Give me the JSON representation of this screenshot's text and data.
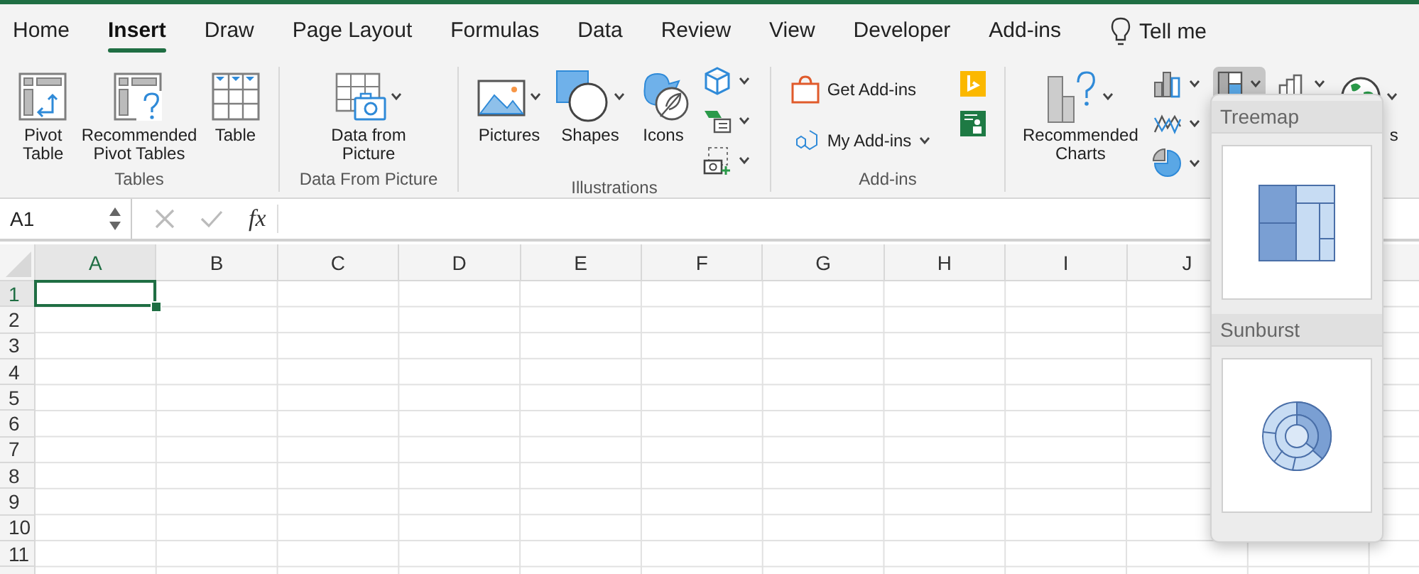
{
  "tabs": [
    {
      "label": "Home",
      "selected": false
    },
    {
      "label": "Insert",
      "selected": true
    },
    {
      "label": "Draw",
      "selected": false
    },
    {
      "label": "Page Layout",
      "selected": false
    },
    {
      "label": "Formulas",
      "selected": false
    },
    {
      "label": "Data",
      "selected": false
    },
    {
      "label": "Review",
      "selected": false
    },
    {
      "label": "View",
      "selected": false
    },
    {
      "label": "Developer",
      "selected": false
    },
    {
      "label": "Add-ins",
      "selected": false
    }
  ],
  "tell_me": "Tell me",
  "ribbon": {
    "groups": [
      {
        "label": "Tables",
        "items": [
          {
            "kind": "large",
            "label": "Pivot\nTable",
            "dropdown": false
          },
          {
            "kind": "large",
            "label": "Recommended\nPivot Tables",
            "dropdown": false
          },
          {
            "kind": "large",
            "label": "Table",
            "dropdown": false
          }
        ]
      },
      {
        "label": "Data From Picture",
        "items": [
          {
            "kind": "large",
            "label": "Data from\nPicture",
            "dropdown": true
          }
        ]
      },
      {
        "label": "Illustrations",
        "items": [
          {
            "kind": "large",
            "label": "Pictures",
            "dropdown": true
          },
          {
            "kind": "large",
            "label": "Shapes",
            "dropdown": true
          },
          {
            "kind": "large",
            "label": "Icons",
            "dropdown": false
          },
          {
            "kind": "stack",
            "items": [
              {
                "dropdown": true
              },
              {
                "dropdown": true
              },
              {
                "dropdown": true
              }
            ]
          }
        ]
      },
      {
        "label": "Add-ins",
        "items": [
          {
            "kind": "stack",
            "items": [
              {
                "label": "Get Add-ins",
                "dropdown": false
              },
              {
                "label": "My Add-ins",
                "dropdown": true
              }
            ]
          },
          {
            "kind": "stack",
            "items": [
              {
                "dropdown": false
              },
              {
                "dropdown": false
              }
            ]
          }
        ]
      },
      {
        "items": [
          {
            "kind": "large",
            "label": "Recommended\nCharts",
            "dropdown": true
          },
          {
            "kind": "stack",
            "items": [
              {
                "dropdown": true
              },
              {
                "dropdown": true
              },
              {
                "dropdown": true
              }
            ]
          },
          {
            "kind": "stack",
            "items": [
              {
                "dropdown": true,
                "pressed": true
              }
            ]
          },
          {
            "kind": "stack",
            "items": [
              {
                "dropdown": true,
                "pressed": false
              }
            ]
          },
          {
            "kind": "large",
            "label": "s",
            "dropdown": true
          }
        ]
      }
    ]
  },
  "formula_bar": {
    "name_box": "A1",
    "function_label": "fx"
  },
  "grid": {
    "columns": [
      {
        "label": "A",
        "selected": true
      },
      {
        "label": "B",
        "selected": false
      },
      {
        "label": "C",
        "selected": false
      },
      {
        "label": "D",
        "selected": false
      },
      {
        "label": "E",
        "selected": false
      },
      {
        "label": "F",
        "selected": false
      },
      {
        "label": "G",
        "selected": false
      },
      {
        "label": "H",
        "selected": false
      },
      {
        "label": "I",
        "selected": false
      },
      {
        "label": "J",
        "selected": false
      }
    ],
    "rows": [
      {
        "label": "1",
        "selected": true
      },
      {
        "label": "2",
        "selected": false
      },
      {
        "label": "3",
        "selected": false
      },
      {
        "label": "4",
        "selected": false
      },
      {
        "label": "5",
        "selected": false
      },
      {
        "label": "6",
        "selected": false
      },
      {
        "label": "7",
        "selected": false
      },
      {
        "label": "8",
        "selected": false
      },
      {
        "label": "9",
        "selected": false
      },
      {
        "label": "10",
        "selected": false
      },
      {
        "label": "11",
        "selected": false
      }
    ]
  },
  "chart_menu": {
    "items": [
      {
        "kind": "treemap",
        "label": "Treemap"
      },
      {
        "kind": "sunburst",
        "label": "Sunburst"
      }
    ]
  }
}
